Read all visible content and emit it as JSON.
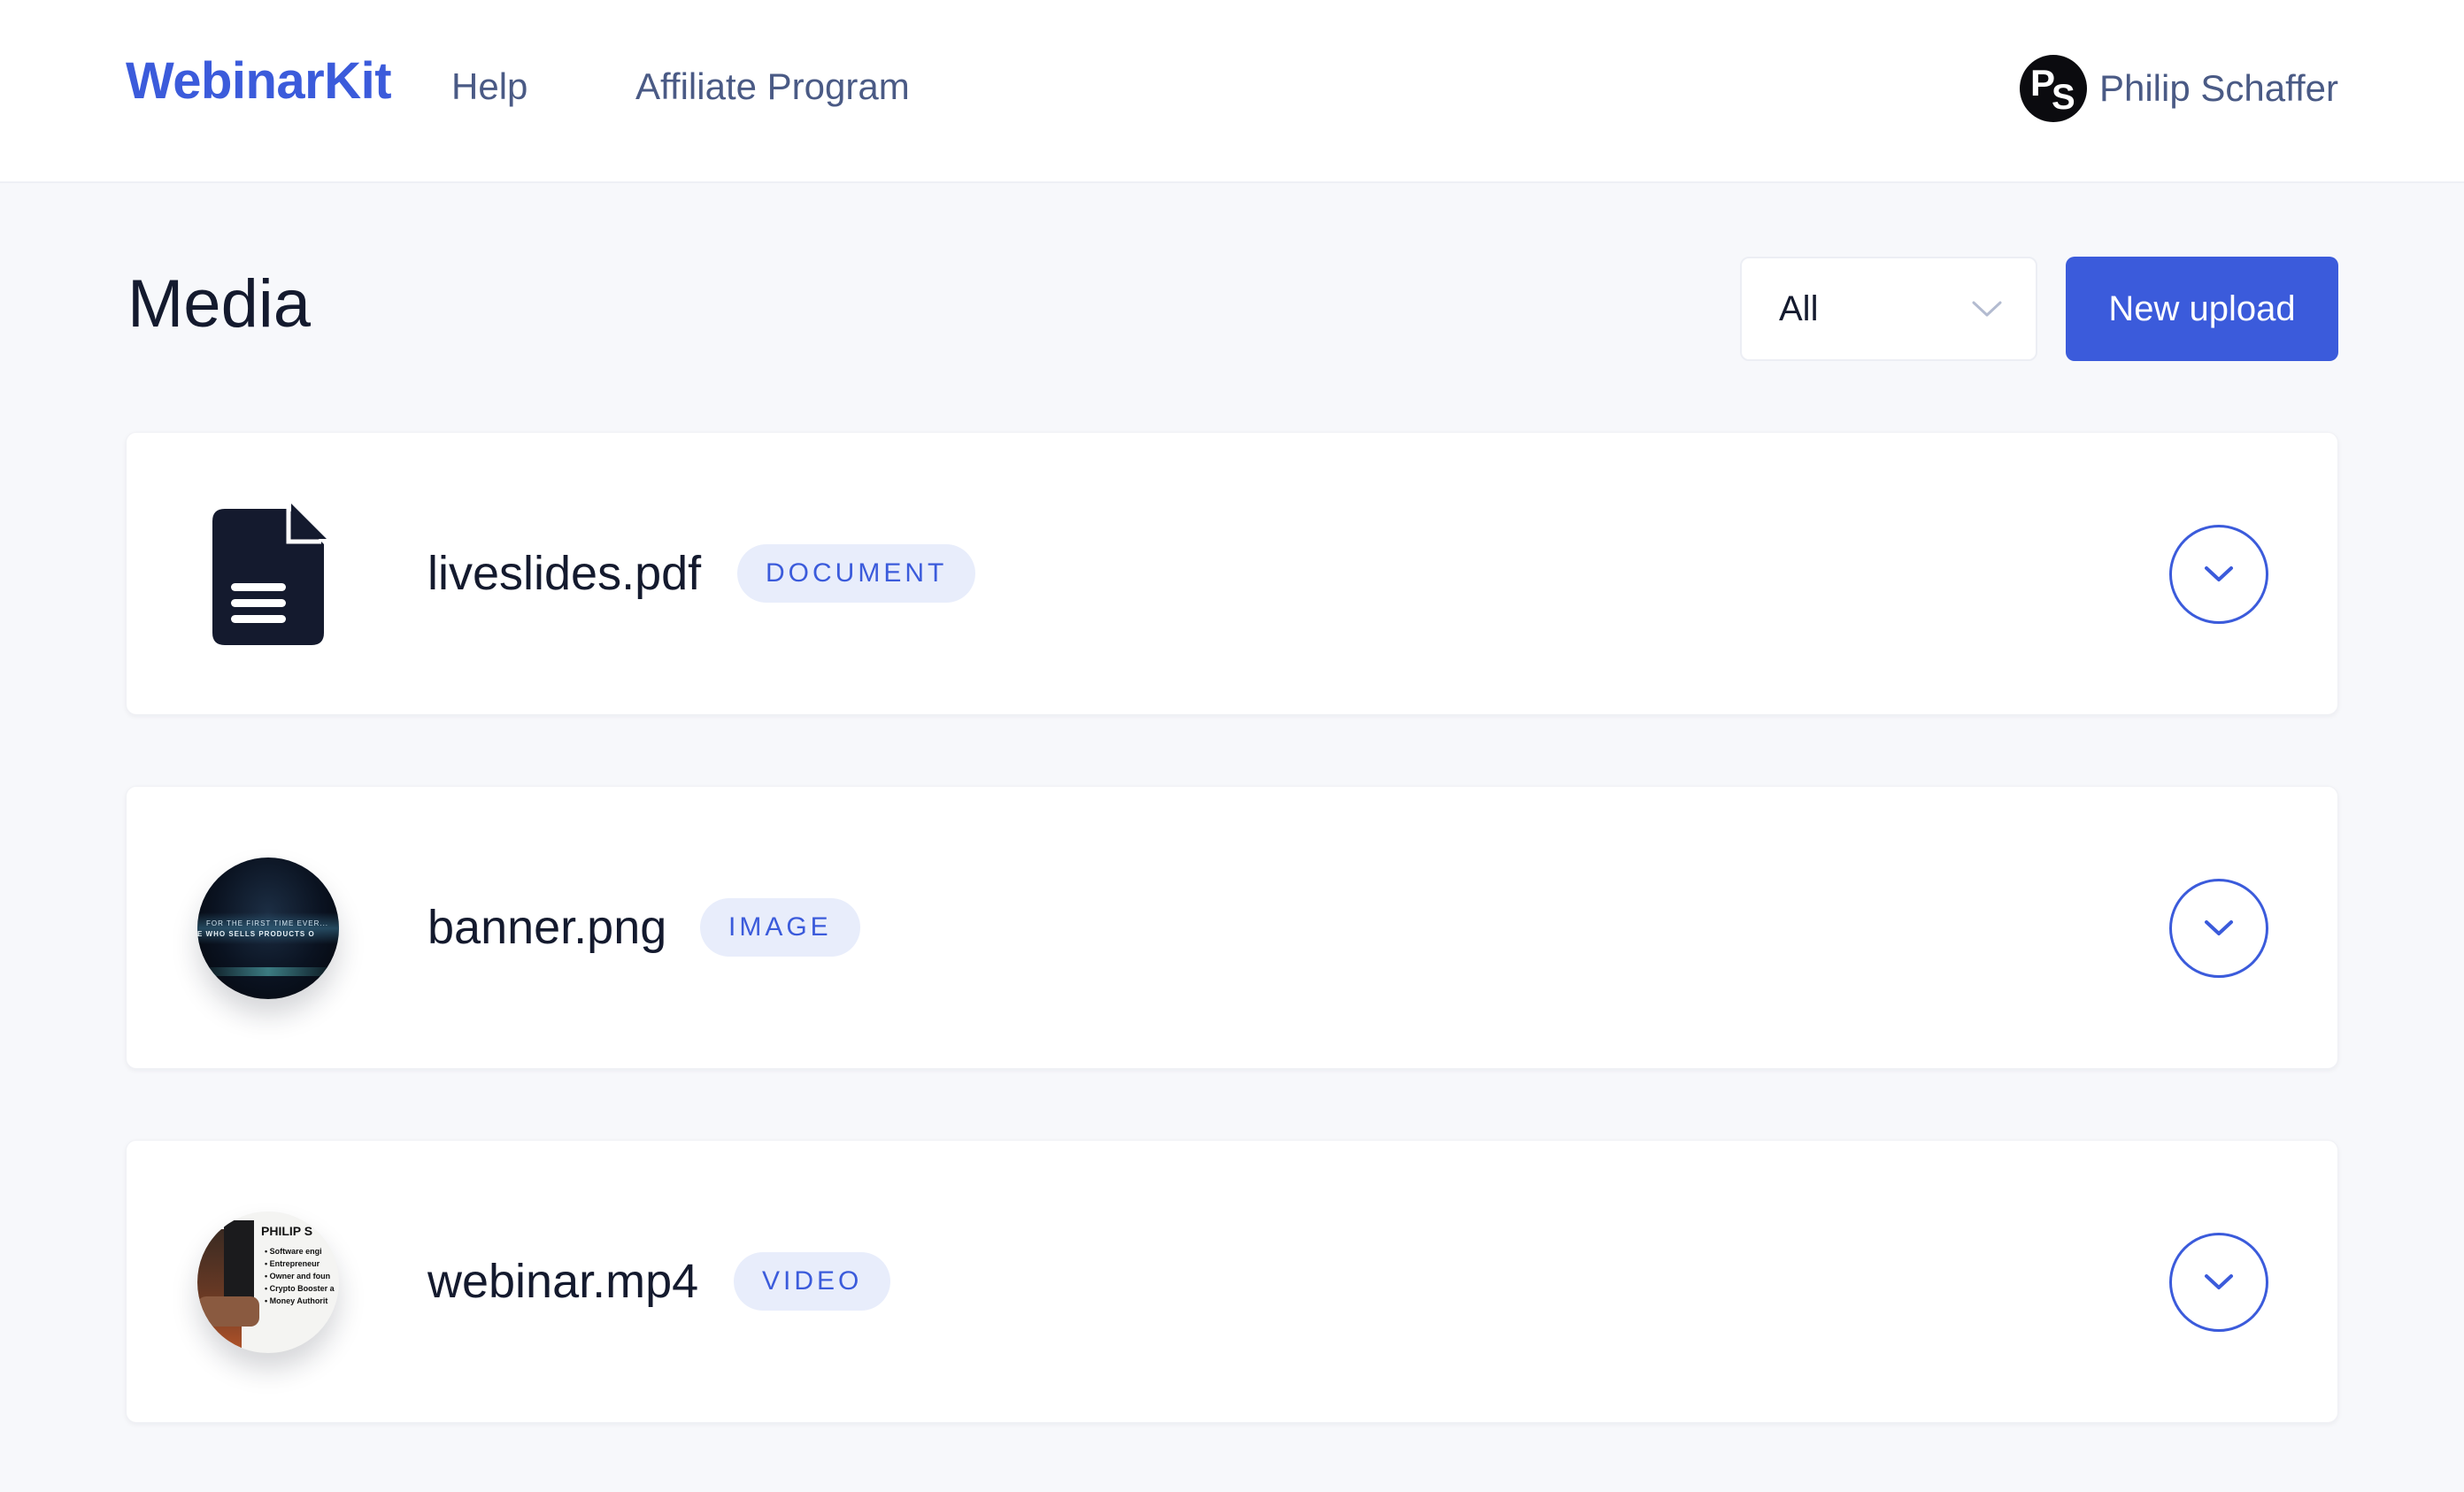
{
  "header": {
    "brand": "WebinarKit",
    "nav": [
      {
        "label": "Help"
      },
      {
        "label": "Affiliate Program"
      }
    ],
    "user": {
      "initials_first": "P",
      "initials_second": "S",
      "name": "Philip Schaffer"
    }
  },
  "page": {
    "title": "Media",
    "filter": {
      "selected": "All",
      "icon": "chevron-down-icon"
    },
    "upload_label": "New upload"
  },
  "media": [
    {
      "filename": "liveslides.pdf",
      "type": "DOCUMENT",
      "thumb": "document-icon"
    },
    {
      "filename": "banner.png",
      "type": "IMAGE",
      "thumb": "image-thumbnail",
      "thumb_text": [
        "FOR THE FIRST TIME EVER...",
        "E WHO SELLS PRODUCTS O"
      ]
    },
    {
      "filename": "webinar.mp4",
      "type": "VIDEO",
      "thumb": "video-thumbnail",
      "thumb_text": [
        "PHILIP S",
        "• Software engi",
        "• Entrepreneur",
        "• Owner and foun",
        "• Crypto Booster a",
        "• Money Authorit"
      ]
    }
  ],
  "colors": {
    "accent": "#3b5bdb",
    "badge_bg": "#e8edfb",
    "text": "#141a2e",
    "muted": "#4a5a85",
    "page_bg": "#f7f8fb"
  }
}
